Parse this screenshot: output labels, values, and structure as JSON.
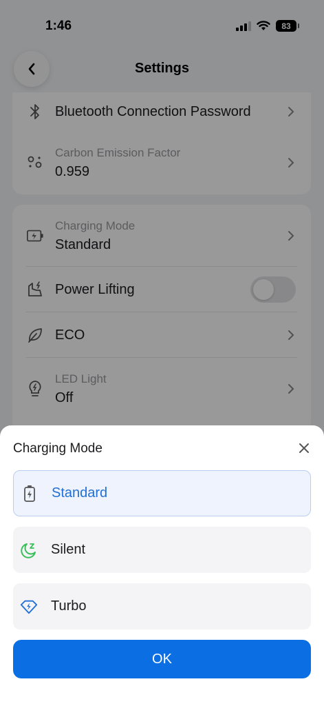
{
  "status_bar": {
    "time": "1:46",
    "battery": "83"
  },
  "nav": {
    "title": "Settings"
  },
  "card1": {
    "bluetooth": {
      "title": "Bluetooth Connection Password"
    },
    "carbon": {
      "label": "Carbon Emission Factor",
      "value": "0.959"
    }
  },
  "card2": {
    "charging_mode": {
      "label": "Charging Mode",
      "value": "Standard"
    },
    "power_lifting": {
      "title": "Power Lifting",
      "enabled": false
    },
    "eco": {
      "title": "ECO"
    },
    "led": {
      "label": "LED Light",
      "value": "Off"
    }
  },
  "sheet": {
    "title": "Charging Mode",
    "options": [
      {
        "label": "Standard",
        "icon": "battery-charging-icon",
        "selected": true
      },
      {
        "label": "Silent",
        "icon": "moon-sleep-icon",
        "selected": false
      },
      {
        "label": "Turbo",
        "icon": "diamond-bolt-icon",
        "selected": false
      }
    ],
    "ok_label": "OK"
  },
  "colors": {
    "accent": "#0b6fe3",
    "selected_bg": "#eef3fd",
    "silent_green": "#3bbf5c"
  }
}
